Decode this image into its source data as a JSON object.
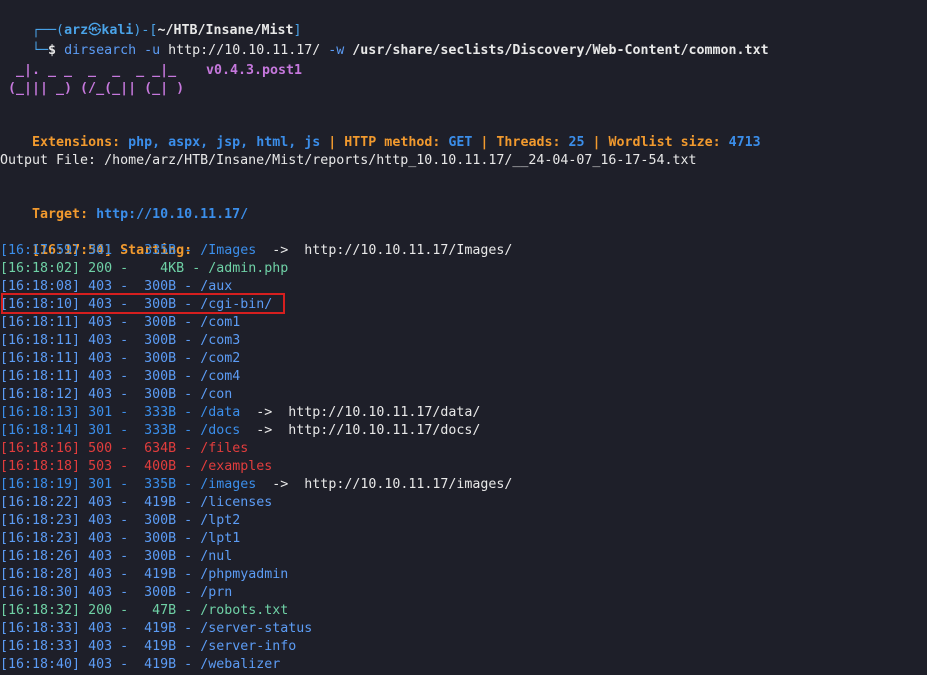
{
  "prompt": {
    "top_left": "┌──(",
    "user": "arz",
    "at": "㉿",
    "host": "kali",
    "mid": ")-[",
    "path": "~/HTB/Insane/Mist",
    "end": "]",
    "bottom_left": "└─",
    "dollar": "$ "
  },
  "command": {
    "name": "dirsearch",
    "flag_u": " -u ",
    "url": "http://10.10.11.17/",
    "flag_w": " -w ",
    "wordlist": "/usr/share/seclists/Discovery/Web-Content/common.txt"
  },
  "banner": {
    "line1": "  _|. _ _  _  _  _ _|_",
    "line2": " (_||| _) (/_(_|| (_| )",
    "version": "v0.4.3.post1"
  },
  "config": {
    "extensions_label": "Extensions: ",
    "extensions": "php, aspx, jsp, html, js",
    "sep1": " | ",
    "method_label": "HTTP method: ",
    "method": "GET",
    "sep2": " | ",
    "threads_label": "Threads: ",
    "threads": "25",
    "sep3": " | ",
    "wordlist_label": "Wordlist size: ",
    "wordlist_size": "4713"
  },
  "output_file": "Output File: /home/arz/HTB/Insane/Mist/reports/http_10.10.11.17/__24-04-07_16-17-54.txt",
  "target": {
    "label": "Target: ",
    "url": "http://10.10.11.17/"
  },
  "starting": {
    "time": "[16:17:54]",
    "label": " Starting: "
  },
  "results": [
    {
      "time": "[16:17:59]",
      "code": "301",
      "size": " 335B",
      "path": "/Images",
      "redirect": "http://10.10.11.17/Images/",
      "cls": "cyan"
    },
    {
      "time": "[16:18:02]",
      "code": "200",
      "size": "   4KB",
      "path": "/admin.php",
      "redirect": "",
      "cls": "green"
    },
    {
      "time": "[16:18:08]",
      "code": "403",
      "size": " 300B",
      "path": "/aux",
      "redirect": "",
      "cls": "blue"
    },
    {
      "time": "[16:18:10]",
      "code": "403",
      "size": " 300B",
      "path": "/cgi-bin/",
      "redirect": "",
      "cls": "blue"
    },
    {
      "time": "[16:18:11]",
      "code": "403",
      "size": " 300B",
      "path": "/com1",
      "redirect": "",
      "cls": "blue"
    },
    {
      "time": "[16:18:11]",
      "code": "403",
      "size": " 300B",
      "path": "/com3",
      "redirect": "",
      "cls": "blue"
    },
    {
      "time": "[16:18:11]",
      "code": "403",
      "size": " 300B",
      "path": "/com2",
      "redirect": "",
      "cls": "blue"
    },
    {
      "time": "[16:18:11]",
      "code": "403",
      "size": " 300B",
      "path": "/com4",
      "redirect": "",
      "cls": "blue"
    },
    {
      "time": "[16:18:12]",
      "code": "403",
      "size": " 300B",
      "path": "/con",
      "redirect": "",
      "cls": "blue"
    },
    {
      "time": "[16:18:13]",
      "code": "301",
      "size": " 333B",
      "path": "/data",
      "redirect": "http://10.10.11.17/data/",
      "cls": "cyan"
    },
    {
      "time": "[16:18:14]",
      "code": "301",
      "size": " 333B",
      "path": "/docs",
      "redirect": "http://10.10.11.17/docs/",
      "cls": "cyan"
    },
    {
      "time": "[16:18:16]",
      "code": "500",
      "size": " 634B",
      "path": "/files",
      "redirect": "",
      "cls": "red"
    },
    {
      "time": "[16:18:18]",
      "code": "503",
      "size": " 400B",
      "path": "/examples",
      "redirect": "",
      "cls": "red"
    },
    {
      "time": "[16:18:19]",
      "code": "301",
      "size": " 335B",
      "path": "/images",
      "redirect": "http://10.10.11.17/images/",
      "cls": "cyan"
    },
    {
      "time": "[16:18:22]",
      "code": "403",
      "size": " 419B",
      "path": "/licenses",
      "redirect": "",
      "cls": "blue"
    },
    {
      "time": "[16:18:23]",
      "code": "403",
      "size": " 300B",
      "path": "/lpt2",
      "redirect": "",
      "cls": "blue"
    },
    {
      "time": "[16:18:23]",
      "code": "403",
      "size": " 300B",
      "path": "/lpt1",
      "redirect": "",
      "cls": "blue"
    },
    {
      "time": "[16:18:26]",
      "code": "403",
      "size": " 300B",
      "path": "/nul",
      "redirect": "",
      "cls": "blue"
    },
    {
      "time": "[16:18:28]",
      "code": "403",
      "size": " 419B",
      "path": "/phpmyadmin",
      "redirect": "",
      "cls": "blue"
    },
    {
      "time": "[16:18:30]",
      "code": "403",
      "size": " 300B",
      "path": "/prn",
      "redirect": "",
      "cls": "blue"
    },
    {
      "time": "[16:18:32]",
      "code": "200",
      "size": "  47B",
      "path": "/robots.txt",
      "redirect": "",
      "cls": "green"
    },
    {
      "time": "[16:18:33]",
      "code": "403",
      "size": " 419B",
      "path": "/server-status",
      "redirect": "",
      "cls": "blue"
    },
    {
      "time": "[16:18:33]",
      "code": "403",
      "size": " 419B",
      "path": "/server-info",
      "redirect": "",
      "cls": "blue"
    },
    {
      "time": "[16:18:40]",
      "code": "403",
      "size": " 419B",
      "path": "/webalizer",
      "redirect": "",
      "cls": "blue"
    }
  ],
  "arrow": "  ->  ",
  "dash": " - ",
  "colors": {
    "background": "#1e1f29",
    "highlight_box": "#d61f1f"
  }
}
